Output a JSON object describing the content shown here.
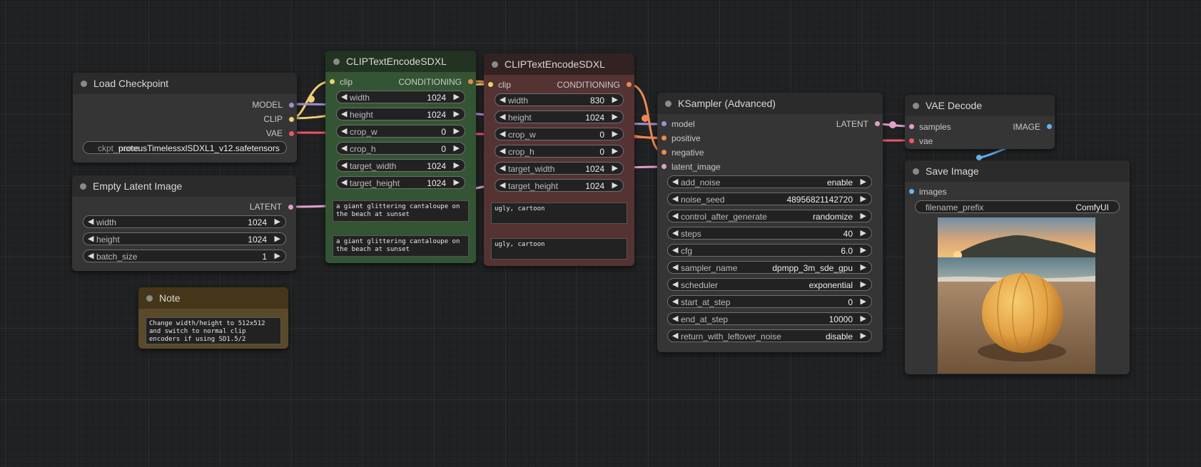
{
  "colors": {
    "clip": "#f0d070",
    "model": "#a58ccf",
    "vae": "#ee5566",
    "latent": "#e0a0c8",
    "conditioning": "#f0884c",
    "image": "#64b5f6"
  },
  "load_checkpoint": {
    "title": "Load Checkpoint",
    "outputs": [
      "MODEL",
      "CLIP",
      "VAE"
    ],
    "ckpt_label": "ckpt_name",
    "ckpt_value": "proteusTimelessxlSDXL1_v12.safetensors"
  },
  "empty_latent": {
    "title": "Empty Latent Image",
    "output": "LATENT",
    "widgets": [
      {
        "label": "width",
        "value": "1024"
      },
      {
        "label": "height",
        "value": "1024"
      },
      {
        "label": "batch_size",
        "value": "1"
      }
    ]
  },
  "note": {
    "title": "Note",
    "text": "Change width/height to 512x512\nand switch to normal clip\nencoders if using SD1.5/2"
  },
  "clip_pos": {
    "title": "CLIPTextEncodeSDXL",
    "input": "clip",
    "output": "CONDITIONING",
    "widgets": [
      {
        "label": "width",
        "value": "1024"
      },
      {
        "label": "height",
        "value": "1024"
      },
      {
        "label": "crop_w",
        "value": "0"
      },
      {
        "label": "crop_h",
        "value": "0"
      },
      {
        "label": "target_width",
        "value": "1024"
      },
      {
        "label": "target_height",
        "value": "1024"
      }
    ],
    "text_g": "a giant glittering cantaloupe on\nthe beach at sunset",
    "text_l": "a giant glittering cantaloupe on\nthe beach at sunset"
  },
  "clip_neg": {
    "title": "CLIPTextEncodeSDXL",
    "input": "clip",
    "output": "CONDITIONING",
    "widgets": [
      {
        "label": "width",
        "value": "830"
      },
      {
        "label": "height",
        "value": "1024"
      },
      {
        "label": "crop_w",
        "value": "0"
      },
      {
        "label": "crop_h",
        "value": "0"
      },
      {
        "label": "target_width",
        "value": "1024"
      },
      {
        "label": "target_height",
        "value": "1024"
      }
    ],
    "text_g": "ugly, cartoon",
    "text_l": "ugly, cartoon"
  },
  "ksampler": {
    "title": "KSampler (Advanced)",
    "inputs": [
      "model",
      "positive",
      "negative",
      "latent_image"
    ],
    "output": "LATENT",
    "widgets": [
      {
        "label": "add_noise",
        "value": "enable"
      },
      {
        "label": "noise_seed",
        "value": "48956821142720"
      },
      {
        "label": "control_after_generate",
        "value": "randomize"
      },
      {
        "label": "steps",
        "value": "40"
      },
      {
        "label": "cfg",
        "value": "6.0"
      },
      {
        "label": "sampler_name",
        "value": "dpmpp_3m_sde_gpu"
      },
      {
        "label": "scheduler",
        "value": "exponential"
      },
      {
        "label": "start_at_step",
        "value": "0"
      },
      {
        "label": "end_at_step",
        "value": "10000"
      },
      {
        "label": "return_with_leftover_noise",
        "value": "disable"
      }
    ]
  },
  "vae_decode": {
    "title": "VAE Decode",
    "inputs": [
      "samples",
      "vae"
    ],
    "output": "IMAGE"
  },
  "save_image": {
    "title": "Save Image",
    "input": "images",
    "prefix_label": "filename_prefix",
    "prefix_value": "ComfyUI"
  }
}
